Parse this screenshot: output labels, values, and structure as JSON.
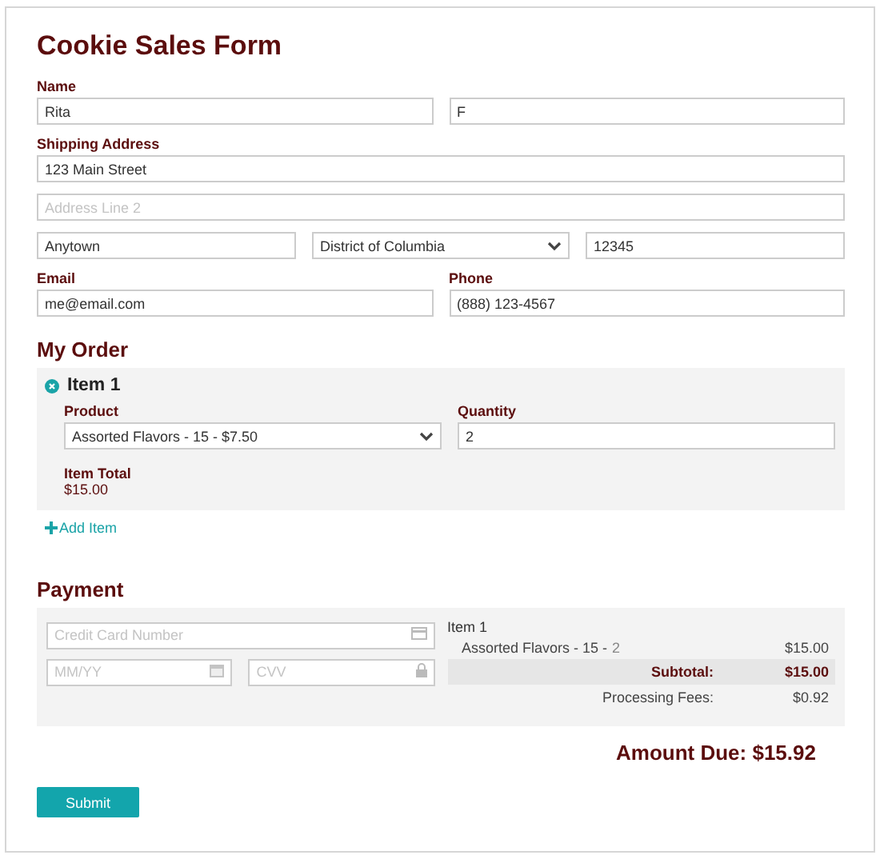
{
  "title": "Cookie Sales Form",
  "name": {
    "label": "Name",
    "first": "Rita",
    "last": "F"
  },
  "address": {
    "label": "Shipping Address",
    "line1": "123 Main Street",
    "line2_placeholder": "Address Line 2",
    "city": "Anytown",
    "state": "District of Columbia",
    "zip": "12345"
  },
  "email": {
    "label": "Email",
    "value": "me@email.com"
  },
  "phone": {
    "label": "Phone",
    "value": "(888) 123-4567"
  },
  "order": {
    "heading": "My Order",
    "items": [
      {
        "title": "Item 1",
        "product_label": "Product",
        "product": "Assorted Flavors - 15 - $7.50",
        "quantity_label": "Quantity",
        "quantity": "2",
        "total_label": "Item Total",
        "total": "$15.00"
      }
    ],
    "add_item": "Add Item"
  },
  "payment": {
    "heading": "Payment",
    "card_placeholder": "Credit Card Number",
    "expiry_placeholder": "MM/YY",
    "cvv_placeholder": "CVV",
    "summary": {
      "item_title": "Item 1",
      "lines": [
        {
          "product": "Assorted Flavors - 15 -",
          "quantity": "2",
          "amount": "$15.00"
        }
      ],
      "subtotal_label": "Subtotal:",
      "subtotal": "$15.00",
      "fees_label": "Processing Fees:",
      "fees": "$0.92"
    },
    "amount_due": "Amount Due: $15.92"
  },
  "submit": "Submit"
}
